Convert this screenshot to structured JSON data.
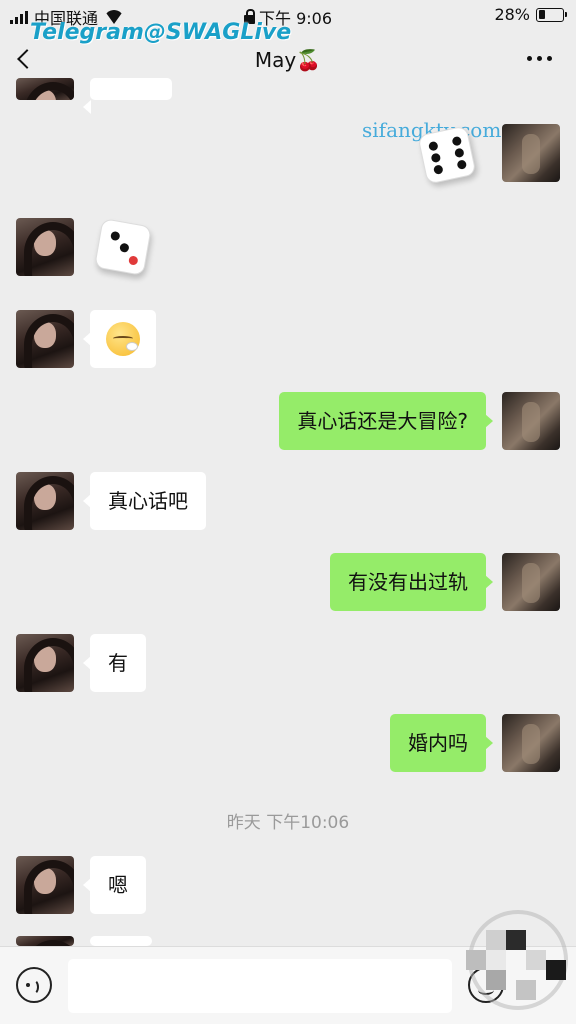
{
  "status_bar": {
    "carrier": "中国联通",
    "time": "下午 9:06",
    "battery_percent": "28%",
    "battery_level": 0.28
  },
  "overlay": {
    "telegram_watermark": "Telegram@SWAGLive",
    "site_watermark": "sifangktv.com"
  },
  "header": {
    "title": "May🍒"
  },
  "messages": [
    {
      "from": "me",
      "type": "dice",
      "face": 6
    },
    {
      "from": "her",
      "type": "dice",
      "face": 3
    },
    {
      "from": "her",
      "type": "emoji",
      "emoji": "face-exhaling-emoji"
    },
    {
      "from": "me",
      "type": "text",
      "text": "真心话还是大冒险?"
    },
    {
      "from": "her",
      "type": "text",
      "text": "真心话吧"
    },
    {
      "from": "me",
      "type": "text",
      "text": "有没有出过轨"
    },
    {
      "from": "her",
      "type": "text",
      "text": "有"
    },
    {
      "from": "me",
      "type": "text",
      "text": "婚内吗"
    },
    {
      "type": "timestamp",
      "text": "昨天 下午10:06"
    },
    {
      "from": "her",
      "type": "text",
      "text": "嗯"
    }
  ],
  "input_bar": {
    "value": "",
    "voice_icon": "voice-icon",
    "emoji_icon": "emoji-icon"
  },
  "colors": {
    "background": "#ededed",
    "outgoing_bubble": "#95ec69",
    "incoming_bubble": "#ffffff",
    "timestamp_text": "#9a9a9a"
  }
}
